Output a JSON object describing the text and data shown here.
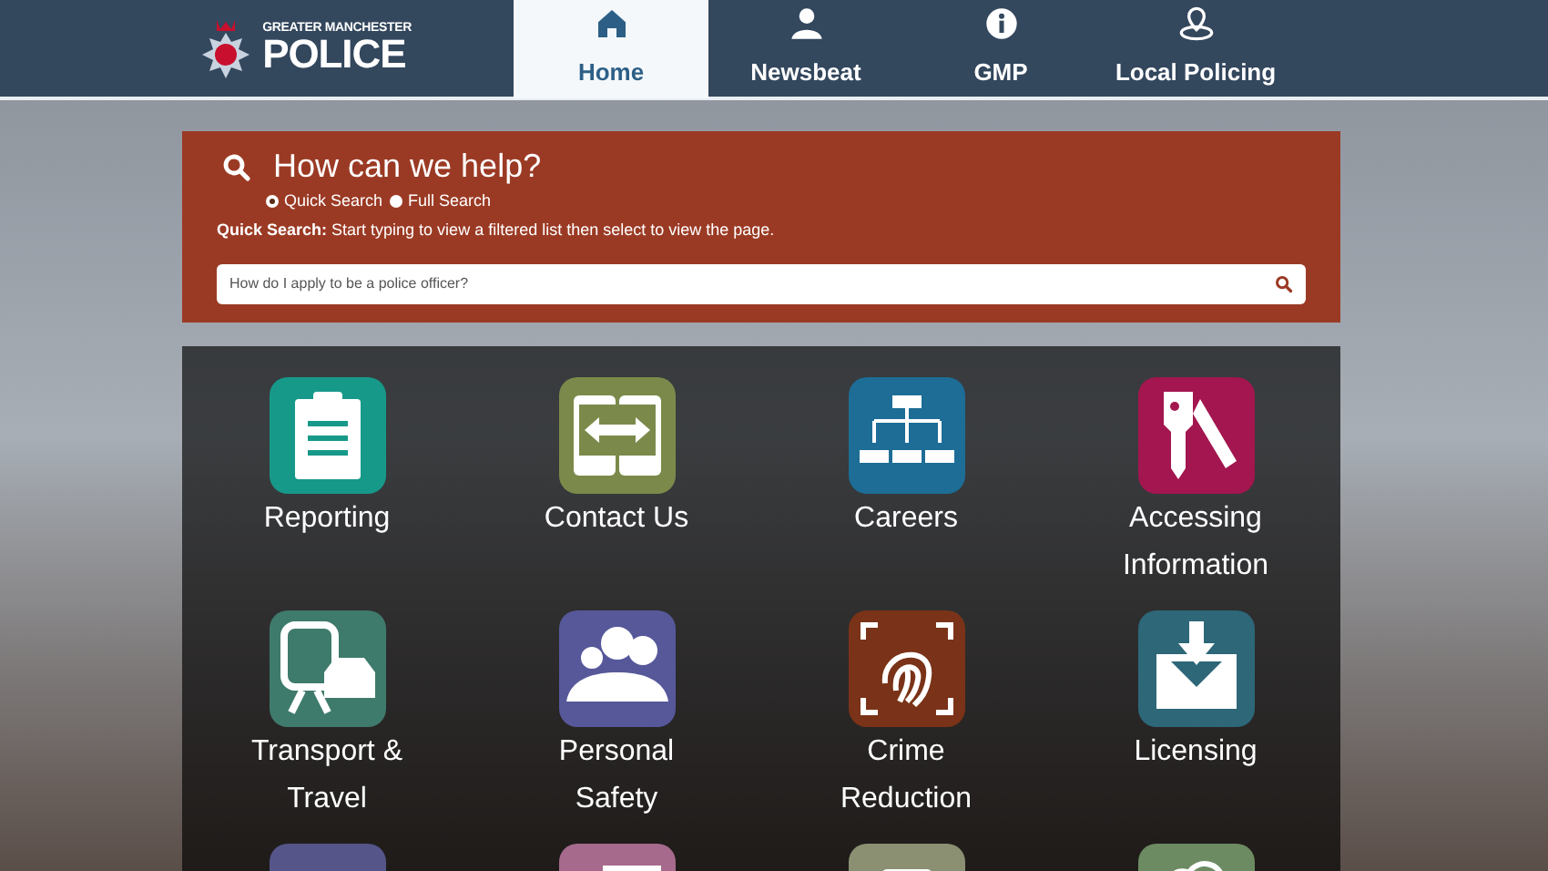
{
  "logo": {
    "line_1": "GREATER MANCHESTER",
    "line_2": "POLICE"
  },
  "nav": [
    {
      "label": "Home",
      "selected": true
    },
    {
      "label": "Newsbeat",
      "selected": false
    },
    {
      "label": "GMP",
      "selected": false
    },
    {
      "label": "Local Policing",
      "selected": false
    }
  ],
  "search": {
    "title": "How can we help?",
    "modes": [
      {
        "label": "Quick Search",
        "selected": true
      },
      {
        "label": "Full Search",
        "selected": false
      }
    ],
    "hint_label": "Quick Search:",
    "hint": "Start typing to view a filtered list then select to view the page.",
    "placeholder": "How do I apply to be a police officer?"
  },
  "tiles": [
    {
      "label": "Reporting",
      "color": "#17998a"
    },
    {
      "label": "Contact Us",
      "color": "#7b8a4b"
    },
    {
      "label": "Careers",
      "color": "#1d6d96"
    },
    {
      "label": "Accessing Information",
      "color": "#a3164f"
    },
    {
      "label": "Transport & Travel",
      "color": "#3f7b6c"
    },
    {
      "label": "Personal Safety",
      "color": "#56589a"
    },
    {
      "label": "Crime Reduction",
      "color": "#7a3318"
    },
    {
      "label": "Licensing",
      "color": "#2d6778"
    },
    {
      "color": "#55558a"
    },
    {
      "color": "#a56a8c"
    },
    {
      "color": "#8b9072"
    },
    {
      "color": "#6d8b62"
    }
  ]
}
